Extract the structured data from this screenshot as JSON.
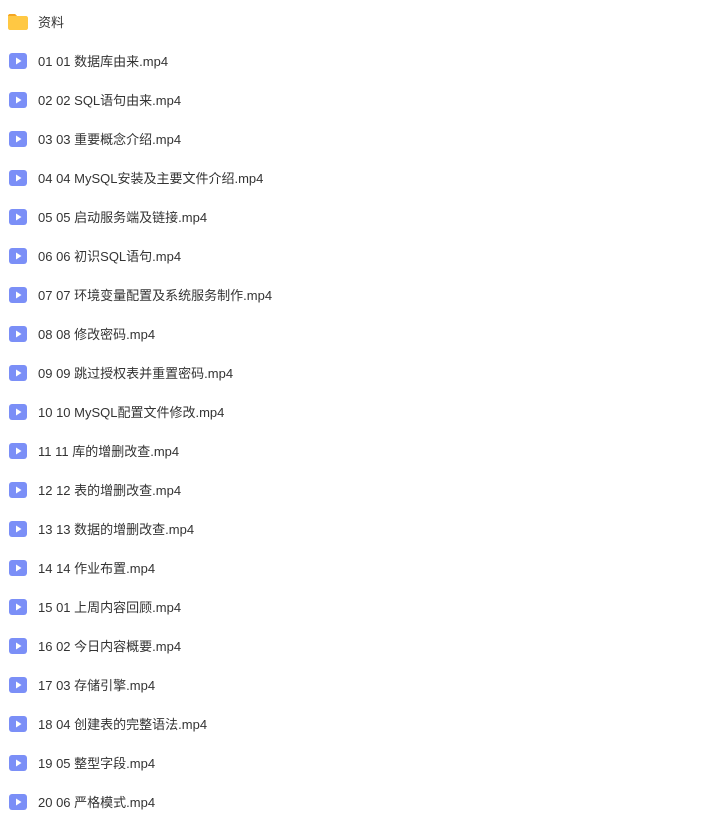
{
  "files": [
    {
      "type": "folder",
      "name": "资料"
    },
    {
      "type": "video",
      "name": "01 01 数据库由来.mp4"
    },
    {
      "type": "video",
      "name": "02 02 SQL语句由来.mp4"
    },
    {
      "type": "video",
      "name": "03 03 重要概念介绍.mp4"
    },
    {
      "type": "video",
      "name": "04 04 MySQL安装及主要文件介绍.mp4"
    },
    {
      "type": "video",
      "name": "05 05 启动服务端及链接.mp4"
    },
    {
      "type": "video",
      "name": "06 06 初识SQL语句.mp4"
    },
    {
      "type": "video",
      "name": "07 07 环境变量配置及系统服务制作.mp4"
    },
    {
      "type": "video",
      "name": "08 08 修改密码.mp4"
    },
    {
      "type": "video",
      "name": "09 09 跳过授权表并重置密码.mp4"
    },
    {
      "type": "video",
      "name": "10 10 MySQL配置文件修改.mp4"
    },
    {
      "type": "video",
      "name": "11 11 库的增删改查.mp4"
    },
    {
      "type": "video",
      "name": "12 12 表的增删改查.mp4"
    },
    {
      "type": "video",
      "name": "13 13 数据的增删改查.mp4"
    },
    {
      "type": "video",
      "name": "14 14 作业布置.mp4"
    },
    {
      "type": "video",
      "name": "15 01 上周内容回顾.mp4"
    },
    {
      "type": "video",
      "name": "16 02 今日内容概要.mp4"
    },
    {
      "type": "video",
      "name": "17 03 存储引擎.mp4"
    },
    {
      "type": "video",
      "name": "18 04 创建表的完整语法.mp4"
    },
    {
      "type": "video",
      "name": "19 05 整型字段.mp4"
    },
    {
      "type": "video",
      "name": "20 06 严格模式.mp4"
    }
  ]
}
